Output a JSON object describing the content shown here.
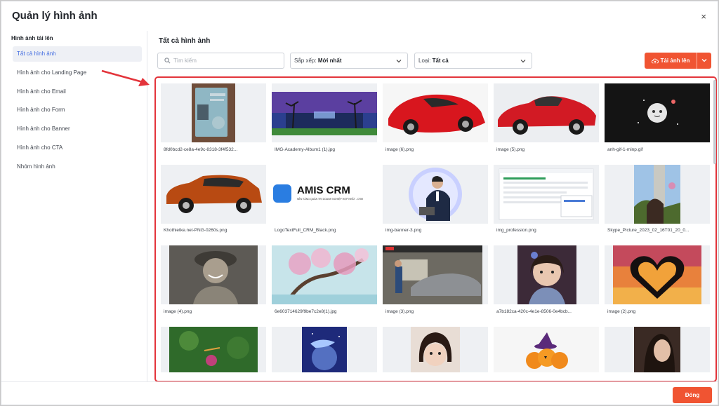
{
  "dialog": {
    "title": "Quản lý hình ảnh",
    "close_icon": "×"
  },
  "sidebar": {
    "heading": "Hình ảnh tải lên",
    "items": [
      {
        "label": "Tất cả hình ảnh",
        "active": true
      },
      {
        "label": "Hình ảnh cho Landing Page"
      },
      {
        "label": "Hình ảnh cho Email"
      },
      {
        "label": "Hình ảnh cho Form"
      },
      {
        "label": "Hình ảnh cho Banner"
      },
      {
        "label": "Hình ảnh cho CTA"
      },
      {
        "label": "Nhóm hình ảnh"
      }
    ]
  },
  "main": {
    "title": "Tất cả hình ảnh",
    "search": {
      "placeholder": "Tìm kiếm",
      "value": ""
    },
    "sort": {
      "label": "Sắp xếp: ",
      "value": "Mới nhất"
    },
    "type": {
      "label": "Loại: ",
      "value": "Tất cả"
    },
    "upload_label": "Tải ảnh lên",
    "images": [
      {
        "name": "8fd0bcd2-ce8a-4e9c-8318-3f4f532..."
      },
      {
        "name": "IMG-Academy-Album1 (1).jpg"
      },
      {
        "name": "image (6).png"
      },
      {
        "name": "image (5).png"
      },
      {
        "name": "anh-gif-1-minp.gif"
      },
      {
        "name": "Khothietke.net-PNG-0260s.png"
      },
      {
        "name": "LogoTextFull_CRM_Black.png",
        "logo_text": "AMIS CRM",
        "logo_sub": "NỀN TẢNG QUẢN TRỊ DOANH NGHIỆP HỢP NHẤT - CRM"
      },
      {
        "name": "img-banner-3.png"
      },
      {
        "name": "img_profession.png"
      },
      {
        "name": "Skype_Picture_2023_02_16T01_20_0..."
      },
      {
        "name": "image (4).png"
      },
      {
        "name": "6e603714629f9be7c2e8(1).jpg"
      },
      {
        "name": "image (3).png"
      },
      {
        "name": "a7b182ca-420c-4e1e-8506-0e4bcb..."
      },
      {
        "name": "image (2).png"
      },
      {
        "name": ""
      },
      {
        "name": ""
      },
      {
        "name": ""
      },
      {
        "name": ""
      },
      {
        "name": ""
      }
    ]
  },
  "footer": {
    "close_label": "Đóng"
  },
  "colors": {
    "accent": "#f05432",
    "highlight_border": "#e3343b",
    "active_text": "#3f6ae0"
  }
}
